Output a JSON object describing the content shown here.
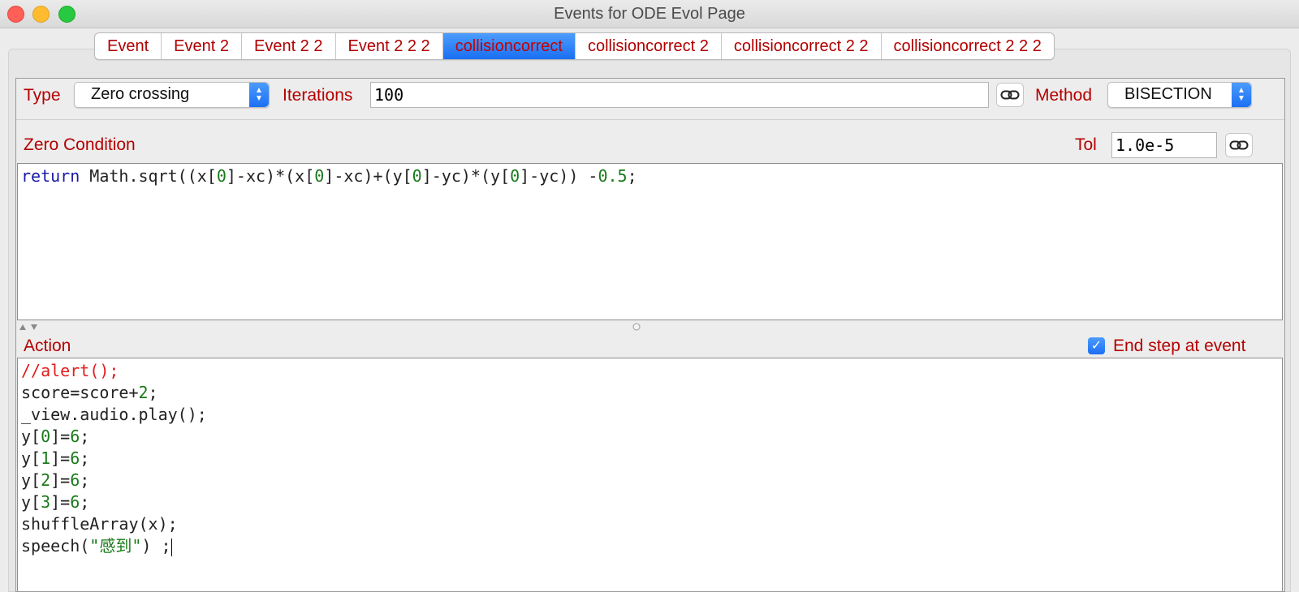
{
  "window": {
    "title": "Events for ODE Evol Page"
  },
  "tabs": [
    {
      "label": "Event"
    },
    {
      "label": "Event 2"
    },
    {
      "label": "Event 2 2"
    },
    {
      "label": "Event 2 2 2"
    },
    {
      "label": "collisioncorrect",
      "active": true
    },
    {
      "label": "collisioncorrect 2"
    },
    {
      "label": "collisioncorrect 2 2"
    },
    {
      "label": "collisioncorrect 2 2 2"
    }
  ],
  "settings": {
    "type_label": "Type",
    "type_value": "Zero crossing",
    "iterations_label": "Iterations",
    "iterations_value": "100",
    "method_label": "Method",
    "method_value": "BISECTION",
    "zero_condition_label": "Zero Condition",
    "tol_label": "Tol",
    "tol_value": "1.0e-5"
  },
  "zero_condition": {
    "code": "return Math.sqrt((x[0]-xc)*(x[0]-xc)+(y[0]-yc)*(y[0]-yc)) -0.5;"
  },
  "action": {
    "label": "Action",
    "end_step_label": "End step at event",
    "end_step_checked": true,
    "lines": [
      "//alert();",
      "score=score+2;",
      "_view.audio.play();",
      "y[0]=6;",
      "y[1]=6;",
      "y[2]=6;",
      "y[3]=6;",
      "shuffleArray(x);",
      "speech(\"感到\") ;"
    ]
  },
  "colors": {
    "label_red": "#b40000",
    "accent_blue": "#1a6ff2",
    "keyword_blue": "#1a1aa6",
    "number_green": "#1a7a1a",
    "comment_red": "#e31b1b"
  },
  "icons": {
    "link_button": "link-icon",
    "combo_arrows": "chevron-updown-icon",
    "checkbox": "check-icon"
  }
}
